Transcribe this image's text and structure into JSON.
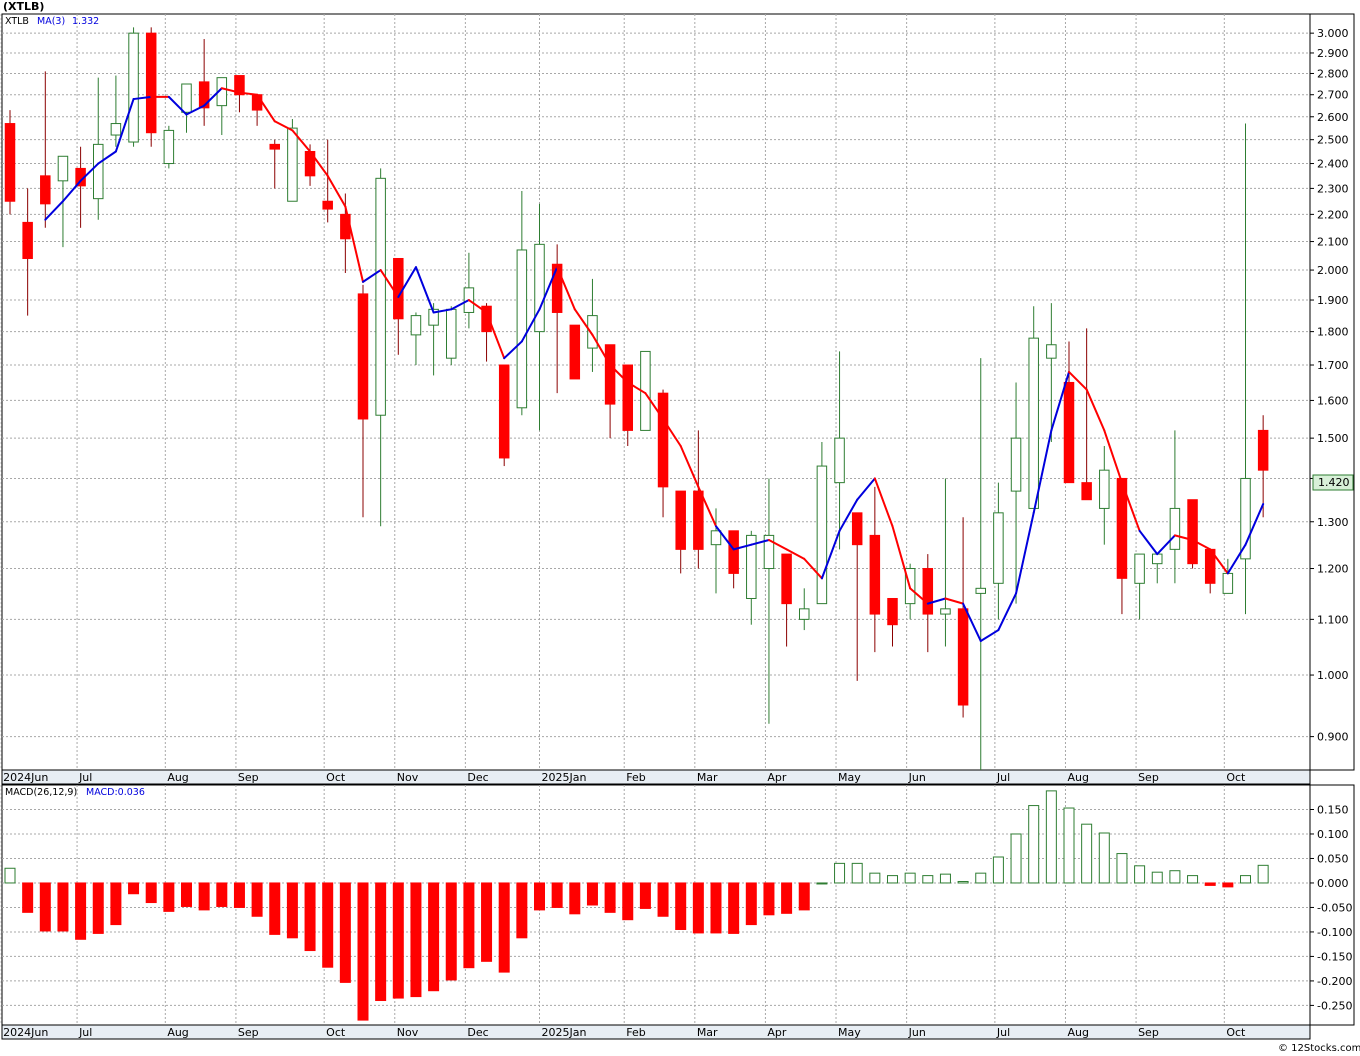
{
  "title": "(XTLB)",
  "watermark": "© 12Stocks.com",
  "colors": {
    "up": "#2e7d32",
    "down": "#ff0000",
    "ma_down": "#ff0000",
    "ma_up": "#0000dd",
    "grid": "#a8a8a8",
    "axis_band": "#e8eef4",
    "last_price_bg": "#d8f0d8"
  },
  "price_panel": {
    "legend_symbol": "XTLB",
    "legend_ma": "MA(3)",
    "legend_ma_value": "1.332",
    "last_price_label": "1.420",
    "ylim": [
      0.85,
      3.1
    ],
    "y_ticks": [
      0.9,
      1.0,
      1.1,
      1.2,
      1.3,
      1.4,
      1.5,
      1.6,
      1.7,
      1.8,
      1.9,
      2.0,
      2.1,
      2.2,
      2.3,
      2.4,
      2.5,
      2.6,
      2.7,
      2.8,
      2.9,
      3.0
    ],
    "y_tick_labels": [
      "0.900",
      "1.000",
      "1.100",
      "1.200",
      "1.300",
      "1.400",
      "1.500",
      "1.600",
      "1.700",
      "1.800",
      "1.900",
      "2.000",
      "2.100",
      "2.200",
      "2.300",
      "2.400",
      "2.500",
      "2.600",
      "2.700",
      "2.800",
      "2.900",
      "3.000"
    ]
  },
  "macd_panel": {
    "legend_label": "MACD(26,12,9)",
    "legend_value": "MACD:0.036",
    "ylim": [
      -0.29,
      0.2
    ],
    "y_ticks": [
      0.15,
      0.1,
      0.05,
      0.0,
      -0.05,
      -0.1,
      -0.15,
      -0.2,
      -0.25
    ],
    "y_tick_labels": [
      "0.150",
      "0.100",
      "0.050",
      "0.000",
      "-0.050",
      "-0.100",
      "-0.150",
      "-0.200",
      "-0.250"
    ]
  },
  "x_labels": [
    {
      "label": "2024Jun",
      "week": -0.5
    },
    {
      "label": "Jul",
      "week": 3.8
    },
    {
      "label": "Aug",
      "week": 8.8
    },
    {
      "label": "Sep",
      "week": 12.8
    },
    {
      "label": "Oct",
      "week": 17.8
    },
    {
      "label": "Nov",
      "week": 21.8
    },
    {
      "label": "Dec",
      "week": 25.8
    },
    {
      "label": "2025Jan",
      "week": 30.0
    },
    {
      "label": "Feb",
      "week": 34.8
    },
    {
      "label": "Mar",
      "week": 38.8
    },
    {
      "label": "Apr",
      "week": 42.8
    },
    {
      "label": "May",
      "week": 46.8
    },
    {
      "label": "Jun",
      "week": 50.8
    },
    {
      "label": "Jul",
      "week": 55.8
    },
    {
      "label": "Aug",
      "week": 59.8
    },
    {
      "label": "Sep",
      "week": 63.8
    },
    {
      "label": "Oct",
      "week": 68.8
    }
  ],
  "chart_data": {
    "type": "candlestick",
    "title": "(XTLB)",
    "x_axis": "weekly, Jun 2024 - Oct 2025",
    "candles": [
      {
        "o": 2.57,
        "h": 2.63,
        "l": 2.2,
        "c": 2.25
      },
      {
        "o": 2.17,
        "h": 2.3,
        "l": 1.85,
        "c": 2.04
      },
      {
        "o": 2.35,
        "h": 2.81,
        "l": 2.15,
        "c": 2.24
      },
      {
        "o": 2.33,
        "h": 2.43,
        "l": 2.08,
        "c": 2.43
      },
      {
        "o": 2.38,
        "h": 2.47,
        "l": 2.15,
        "c": 2.31
      },
      {
        "o": 2.26,
        "h": 2.78,
        "l": 2.18,
        "c": 2.48
      },
      {
        "o": 2.52,
        "h": 2.79,
        "l": 2.47,
        "c": 2.57
      },
      {
        "o": 2.49,
        "h": 3.03,
        "l": 2.47,
        "c": 3.0
      },
      {
        "o": 3.0,
        "h": 3.03,
        "l": 2.47,
        "c": 2.53
      },
      {
        "o": 2.4,
        "h": 2.56,
        "l": 2.38,
        "c": 2.54
      },
      {
        "o": 2.62,
        "h": 2.75,
        "l": 2.53,
        "c": 2.75
      },
      {
        "o": 2.76,
        "h": 2.97,
        "l": 2.56,
        "c": 2.64
      },
      {
        "o": 2.65,
        "h": 2.78,
        "l": 2.52,
        "c": 2.78
      },
      {
        "o": 2.79,
        "h": 2.79,
        "l": 2.62,
        "c": 2.7
      },
      {
        "o": 2.7,
        "h": 2.7,
        "l": 2.56,
        "c": 2.63
      },
      {
        "o": 2.48,
        "h": 2.5,
        "l": 2.3,
        "c": 2.46
      },
      {
        "o": 2.25,
        "h": 2.59,
        "l": 2.25,
        "c": 2.55
      },
      {
        "o": 2.45,
        "h": 2.48,
        "l": 2.31,
        "c": 2.35
      },
      {
        "o": 2.25,
        "h": 2.5,
        "l": 2.17,
        "c": 2.22
      },
      {
        "o": 2.2,
        "h": 2.28,
        "l": 1.99,
        "c": 2.11
      },
      {
        "o": 1.92,
        "h": 1.95,
        "l": 1.31,
        "c": 1.55
      },
      {
        "o": 1.56,
        "h": 2.38,
        "l": 1.29,
        "c": 2.34
      },
      {
        "o": 2.04,
        "h": 2.04,
        "l": 1.73,
        "c": 1.84
      },
      {
        "o": 1.79,
        "h": 1.86,
        "l": 1.7,
        "c": 1.85
      },
      {
        "o": 1.82,
        "h": 1.89,
        "l": 1.67,
        "c": 1.87
      },
      {
        "o": 1.72,
        "h": 1.88,
        "l": 1.7,
        "c": 1.87
      },
      {
        "o": 1.86,
        "h": 2.06,
        "l": 1.81,
        "c": 1.94
      },
      {
        "o": 1.88,
        "h": 1.89,
        "l": 1.71,
        "c": 1.8
      },
      {
        "o": 1.7,
        "h": 1.7,
        "l": 1.43,
        "c": 1.45
      },
      {
        "o": 1.58,
        "h": 2.29,
        "l": 1.56,
        "c": 2.07
      },
      {
        "o": 1.8,
        "h": 2.24,
        "l": 1.52,
        "c": 2.09
      },
      {
        "o": 2.02,
        "h": 2.09,
        "l": 1.62,
        "c": 1.86
      },
      {
        "o": 1.82,
        "h": 1.82,
        "l": 1.66,
        "c": 1.66
      },
      {
        "o": 1.75,
        "h": 1.97,
        "l": 1.68,
        "c": 1.85
      },
      {
        "o": 1.76,
        "h": 1.76,
        "l": 1.5,
        "c": 1.59
      },
      {
        "o": 1.7,
        "h": 1.7,
        "l": 1.48,
        "c": 1.52
      },
      {
        "o": 1.52,
        "h": 1.74,
        "l": 1.52,
        "c": 1.74
      },
      {
        "o": 1.62,
        "h": 1.63,
        "l": 1.31,
        "c": 1.38
      },
      {
        "o": 1.37,
        "h": 1.37,
        "l": 1.19,
        "c": 1.24
      },
      {
        "o": 1.37,
        "h": 1.52,
        "l": 1.2,
        "c": 1.24
      },
      {
        "o": 1.25,
        "h": 1.33,
        "l": 1.15,
        "c": 1.28
      },
      {
        "o": 1.28,
        "h": 1.28,
        "l": 1.16,
        "c": 1.19
      },
      {
        "o": 1.14,
        "h": 1.28,
        "l": 1.09,
        "c": 1.27
      },
      {
        "o": 1.2,
        "h": 1.4,
        "l": 0.92,
        "c": 1.27
      },
      {
        "o": 1.23,
        "h": 1.23,
        "l": 1.05,
        "c": 1.13
      },
      {
        "o": 1.1,
        "h": 1.16,
        "l": 1.08,
        "c": 1.12
      },
      {
        "o": 1.13,
        "h": 1.49,
        "l": 1.13,
        "c": 1.43
      },
      {
        "o": 1.39,
        "h": 1.74,
        "l": 1.24,
        "c": 1.5
      },
      {
        "o": 1.32,
        "h": 1.32,
        "l": 0.99,
        "c": 1.25
      },
      {
        "o": 1.27,
        "h": 1.38,
        "l": 1.04,
        "c": 1.11
      },
      {
        "o": 1.14,
        "h": 1.14,
        "l": 1.05,
        "c": 1.09
      },
      {
        "o": 1.13,
        "h": 1.21,
        "l": 1.1,
        "c": 1.2
      },
      {
        "o": 1.2,
        "h": 1.23,
        "l": 1.04,
        "c": 1.11
      },
      {
        "o": 1.11,
        "h": 1.4,
        "l": 1.05,
        "c": 1.12
      },
      {
        "o": 1.12,
        "h": 1.31,
        "l": 0.93,
        "c": 0.95
      },
      {
        "o": 1.15,
        "h": 1.72,
        "l": 0.85,
        "c": 1.16
      },
      {
        "o": 1.17,
        "h": 1.39,
        "l": 1.1,
        "c": 1.32
      },
      {
        "o": 1.37,
        "h": 1.65,
        "l": 1.13,
        "c": 1.5
      },
      {
        "o": 1.33,
        "h": 1.88,
        "l": 1.33,
        "c": 1.78
      },
      {
        "o": 1.72,
        "h": 1.89,
        "l": 1.49,
        "c": 1.76
      },
      {
        "o": 1.65,
        "h": 1.77,
        "l": 1.39,
        "c": 1.39
      },
      {
        "o": 1.39,
        "h": 1.81,
        "l": 1.35,
        "c": 1.35
      },
      {
        "o": 1.33,
        "h": 1.48,
        "l": 1.25,
        "c": 1.42
      },
      {
        "o": 1.4,
        "h": 1.4,
        "l": 1.11,
        "c": 1.18
      },
      {
        "o": 1.17,
        "h": 1.23,
        "l": 1.1,
        "c": 1.23
      },
      {
        "o": 1.21,
        "h": 1.23,
        "l": 1.17,
        "c": 1.23
      },
      {
        "o": 1.24,
        "h": 1.52,
        "l": 1.17,
        "c": 1.33
      },
      {
        "o": 1.35,
        "h": 1.35,
        "l": 1.2,
        "c": 1.21
      },
      {
        "o": 1.24,
        "h": 1.24,
        "l": 1.15,
        "c": 1.17
      },
      {
        "o": 1.15,
        "h": 1.22,
        "l": 1.15,
        "c": 1.19
      },
      {
        "o": 1.22,
        "h": 2.57,
        "l": 1.11,
        "c": 1.4
      },
      {
        "o": 1.52,
        "h": 1.56,
        "l": 1.31,
        "c": 1.42
      }
    ],
    "ma": [
      null,
      null,
      2.18,
      2.25,
      2.33,
      2.4,
      2.45,
      2.68,
      2.69,
      2.69,
      2.61,
      2.65,
      2.73,
      2.71,
      2.7,
      2.58,
      2.54,
      2.45,
      2.35,
      2.23,
      1.96,
      2.0,
      1.91,
      2.01,
      1.86,
      1.87,
      1.9,
      1.86,
      1.72,
      1.77,
      1.87,
      2.01,
      1.87,
      1.79,
      1.7,
      1.65,
      1.62,
      1.55,
      1.48,
      1.38,
      1.29,
      1.24,
      1.25,
      1.26,
      1.24,
      1.22,
      1.18,
      1.28,
      1.35,
      1.4,
      1.29,
      1.16,
      1.13,
      1.14,
      1.13,
      1.06,
      1.08,
      1.15,
      1.32,
      1.52,
      1.68,
      1.63,
      1.52,
      1.39,
      1.28,
      1.23,
      1.27,
      1.26,
      1.24,
      1.19,
      1.25,
      1.34
    ],
    "ma_trend_up": [
      false,
      false,
      true,
      true,
      true,
      true,
      true,
      true,
      true,
      false,
      true,
      true,
      true,
      false,
      false,
      false,
      false,
      false,
      false,
      false,
      false,
      true,
      false,
      true,
      true,
      true,
      true,
      false,
      false,
      true,
      true,
      true,
      false,
      false,
      false,
      false,
      false,
      false,
      false,
      false,
      false,
      true,
      true,
      true,
      false,
      false,
      false,
      true,
      true,
      true,
      false,
      false,
      false,
      true,
      false,
      true,
      true,
      true,
      true,
      true,
      true,
      false,
      false,
      false,
      false,
      true,
      true,
      false,
      false,
      false,
      true,
      true
    ],
    "macd": [
      0.03,
      -0.06,
      -0.098,
      -0.098,
      -0.115,
      -0.103,
      -0.085,
      -0.022,
      -0.04,
      -0.058,
      -0.048,
      -0.055,
      -0.048,
      -0.05,
      -0.068,
      -0.105,
      -0.112,
      -0.138,
      -0.172,
      -0.203,
      -0.28,
      -0.24,
      -0.235,
      -0.232,
      -0.22,
      -0.198,
      -0.173,
      -0.16,
      -0.182,
      -0.112,
      -0.055,
      -0.05,
      -0.063,
      -0.045,
      -0.06,
      -0.075,
      -0.052,
      -0.068,
      -0.095,
      -0.102,
      -0.102,
      -0.103,
      -0.085,
      -0.065,
      -0.062,
      -0.055,
      0.0,
      0.04,
      0.04,
      0.02,
      0.015,
      0.02,
      0.015,
      0.018,
      0.003,
      0.02,
      0.053,
      0.1,
      0.158,
      0.188,
      0.153,
      0.12,
      0.102,
      0.06,
      0.035,
      0.022,
      0.025,
      0.015,
      -0.005,
      -0.008,
      0.015,
      0.036
    ]
  }
}
